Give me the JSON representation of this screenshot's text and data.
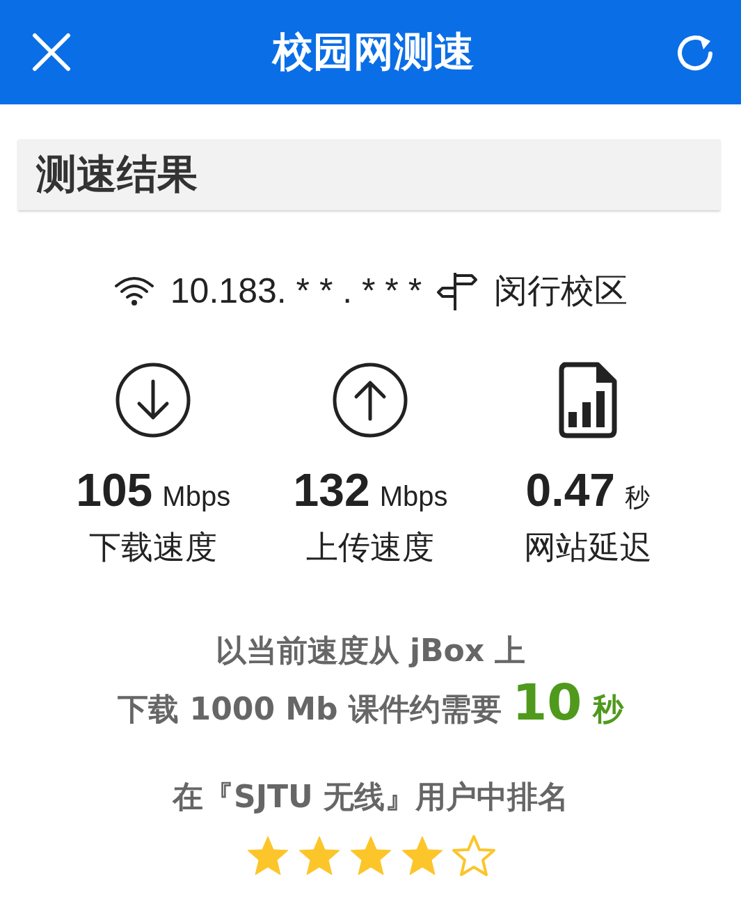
{
  "header": {
    "title": "校园网测速"
  },
  "section": {
    "title": "测速结果"
  },
  "connection": {
    "ip": "10.183. * * . * * *",
    "campus": "闵行校区"
  },
  "metrics": [
    {
      "kind": "download",
      "value": "105",
      "unit": "Mbps",
      "label": "下载速度"
    },
    {
      "kind": "upload",
      "value": "132",
      "unit": "Mbps",
      "label": "上传速度"
    },
    {
      "kind": "latency",
      "value": "0.47",
      "unit": "秒",
      "label": "网站延迟"
    }
  ],
  "estimate": {
    "line_1": "以当前速度从 jBox 上",
    "line_2": "下载 1000 Mb 课件约需要",
    "time": "10",
    "time_unit": "秒"
  },
  "ranking": {
    "text": "在『SJTU 无线』用户中排名",
    "stars": 4
  }
}
